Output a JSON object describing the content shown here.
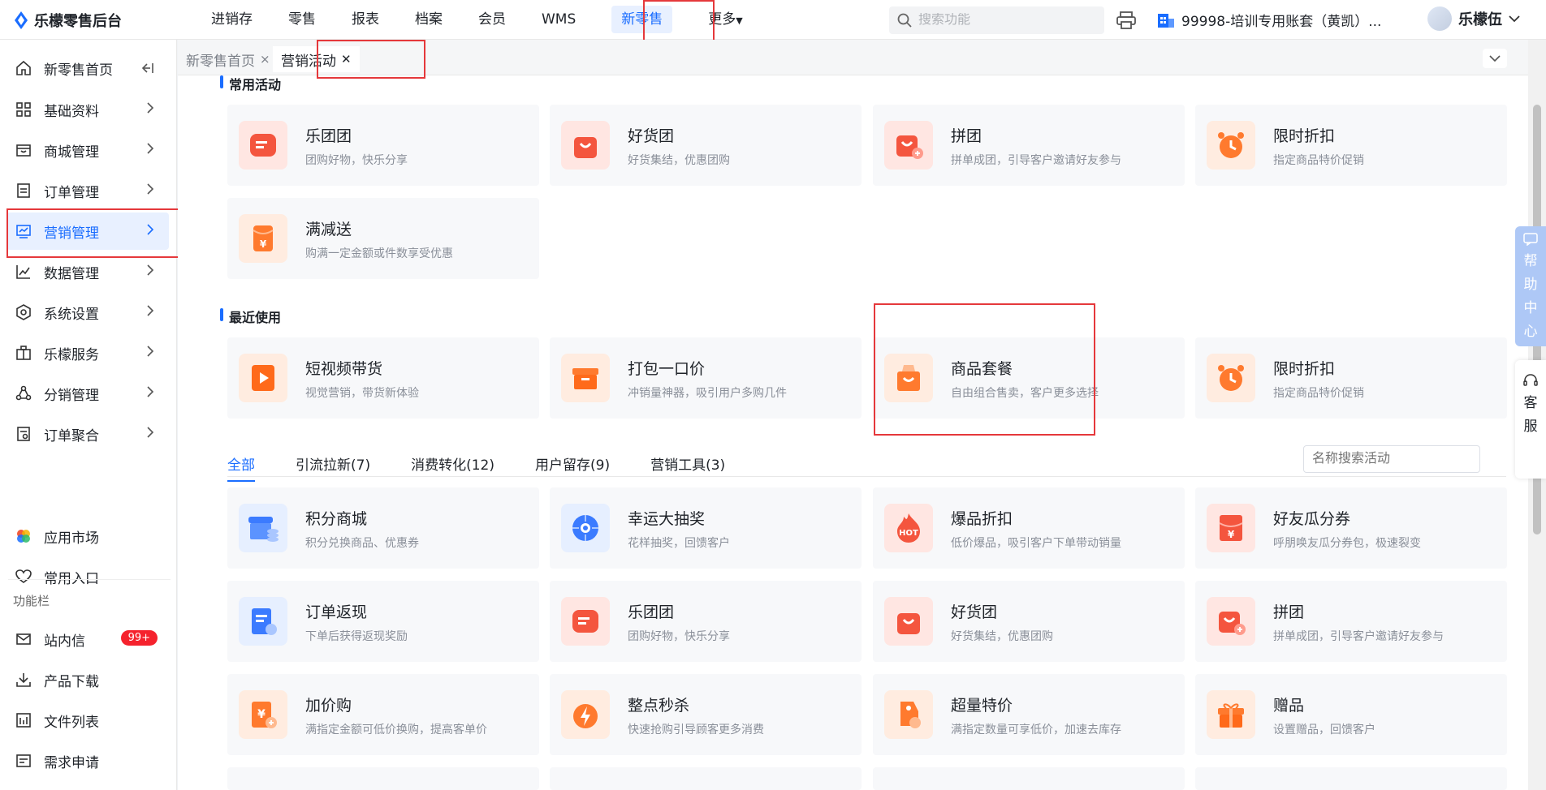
{
  "app": {
    "brand": "乐檬零售后台"
  },
  "topnav": [
    "进销存",
    "零售",
    "报表",
    "档案",
    "会员",
    "WMS",
    "新零售",
    "更多"
  ],
  "topnav_active": 6,
  "search": {
    "placeholder": "搜索功能"
  },
  "account": {
    "name": "99998-培训专用账套（黄凯）..."
  },
  "user": {
    "name": "乐檬伍"
  },
  "sidebar": {
    "items": [
      {
        "label": "新零售首页",
        "icon": "home-icon"
      },
      {
        "label": "基础资料",
        "icon": "grid-icon"
      },
      {
        "label": "商城管理",
        "icon": "shop-icon"
      },
      {
        "label": "订单管理",
        "icon": "order-icon"
      },
      {
        "label": "营销管理",
        "icon": "marketing-icon"
      },
      {
        "label": "数据管理",
        "icon": "chart-icon"
      },
      {
        "label": "系统设置",
        "icon": "settings-icon"
      },
      {
        "label": "乐檬服务",
        "icon": "service-icon"
      },
      {
        "label": "分销管理",
        "icon": "distribution-icon"
      },
      {
        "label": "订单聚合",
        "icon": "aggregate-icon"
      }
    ],
    "bottom": [
      {
        "label": "应用市场",
        "icon": "app-market-icon"
      },
      {
        "label": "常用入口",
        "icon": "heart-icon"
      }
    ],
    "section_label": "功能栏",
    "tools": [
      {
        "label": "站内信",
        "icon": "mail-icon"
      },
      {
        "label": "产品下载",
        "icon": "download-icon"
      },
      {
        "label": "文件列表",
        "icon": "file-list-icon"
      },
      {
        "label": "需求申请",
        "icon": "request-icon"
      }
    ],
    "badge": "99+"
  },
  "tabs": [
    {
      "label": "新零售首页",
      "close": "×"
    },
    {
      "label": "营销活动",
      "close": "✕"
    }
  ],
  "common": {
    "title": "常用活动",
    "cards": [
      {
        "title": "乐团团",
        "desc": "团购好物，快乐分享"
      },
      {
        "title": "好货团",
        "desc": "好货集结，优惠团购"
      },
      {
        "title": "拼团",
        "desc": "拼单成团，引导客户邀请好友参与"
      },
      {
        "title": "限时折扣",
        "desc": "指定商品特价促销"
      },
      {
        "title": "满减送",
        "desc": "购满一定金额或件数享受优惠"
      }
    ]
  },
  "recent": {
    "title": "最近使用",
    "cards": [
      {
        "title": "短视频带货",
        "desc": "视觉营销，带货新体验"
      },
      {
        "title": "打包一口价",
        "desc": "冲销量神器，吸引用户多购几件"
      },
      {
        "title": "商品套餐",
        "desc": "自由组合售卖，客户更多选择"
      },
      {
        "title": "限时折扣",
        "desc": "指定商品特价促销"
      }
    ]
  },
  "categories": [
    "全部",
    "引流拉新(7)",
    "消费转化(12)",
    "用户留存(9)",
    "营销工具(3)"
  ],
  "name_search": {
    "placeholder": "名称搜索活动"
  },
  "all": {
    "cards": [
      {
        "title": "积分商城",
        "desc": "积分兑换商品、优惠券"
      },
      {
        "title": "幸运大抽奖",
        "desc": "花样抽奖，回馈客户"
      },
      {
        "title": "爆品折扣",
        "desc": "低价爆品，吸引客户下单带动销量"
      },
      {
        "title": "好友瓜分券",
        "desc": "呼朋唤友瓜分券包，极速裂变"
      },
      {
        "title": "订单返现",
        "desc": "下单后获得返现奖励"
      },
      {
        "title": "乐团团",
        "desc": "团购好物，快乐分享"
      },
      {
        "title": "好货团",
        "desc": "好货集结，优惠团购"
      },
      {
        "title": "拼团",
        "desc": "拼单成团，引导客户邀请好友参与"
      },
      {
        "title": "加价购",
        "desc": "满指定金额可低价换购，提高客单价"
      },
      {
        "title": "整点秒杀",
        "desc": "快速抢购引导顾客更多消费"
      },
      {
        "title": "超量特价",
        "desc": "满指定数量可享低价，加速去库存"
      },
      {
        "title": "赠品",
        "desc": "设置赠品，回馈客户"
      }
    ]
  },
  "hot_label": "HOT",
  "yuan_label": "¥",
  "help": [
    "帮",
    "助",
    "中",
    "心"
  ],
  "kefu": [
    "客",
    "服"
  ]
}
